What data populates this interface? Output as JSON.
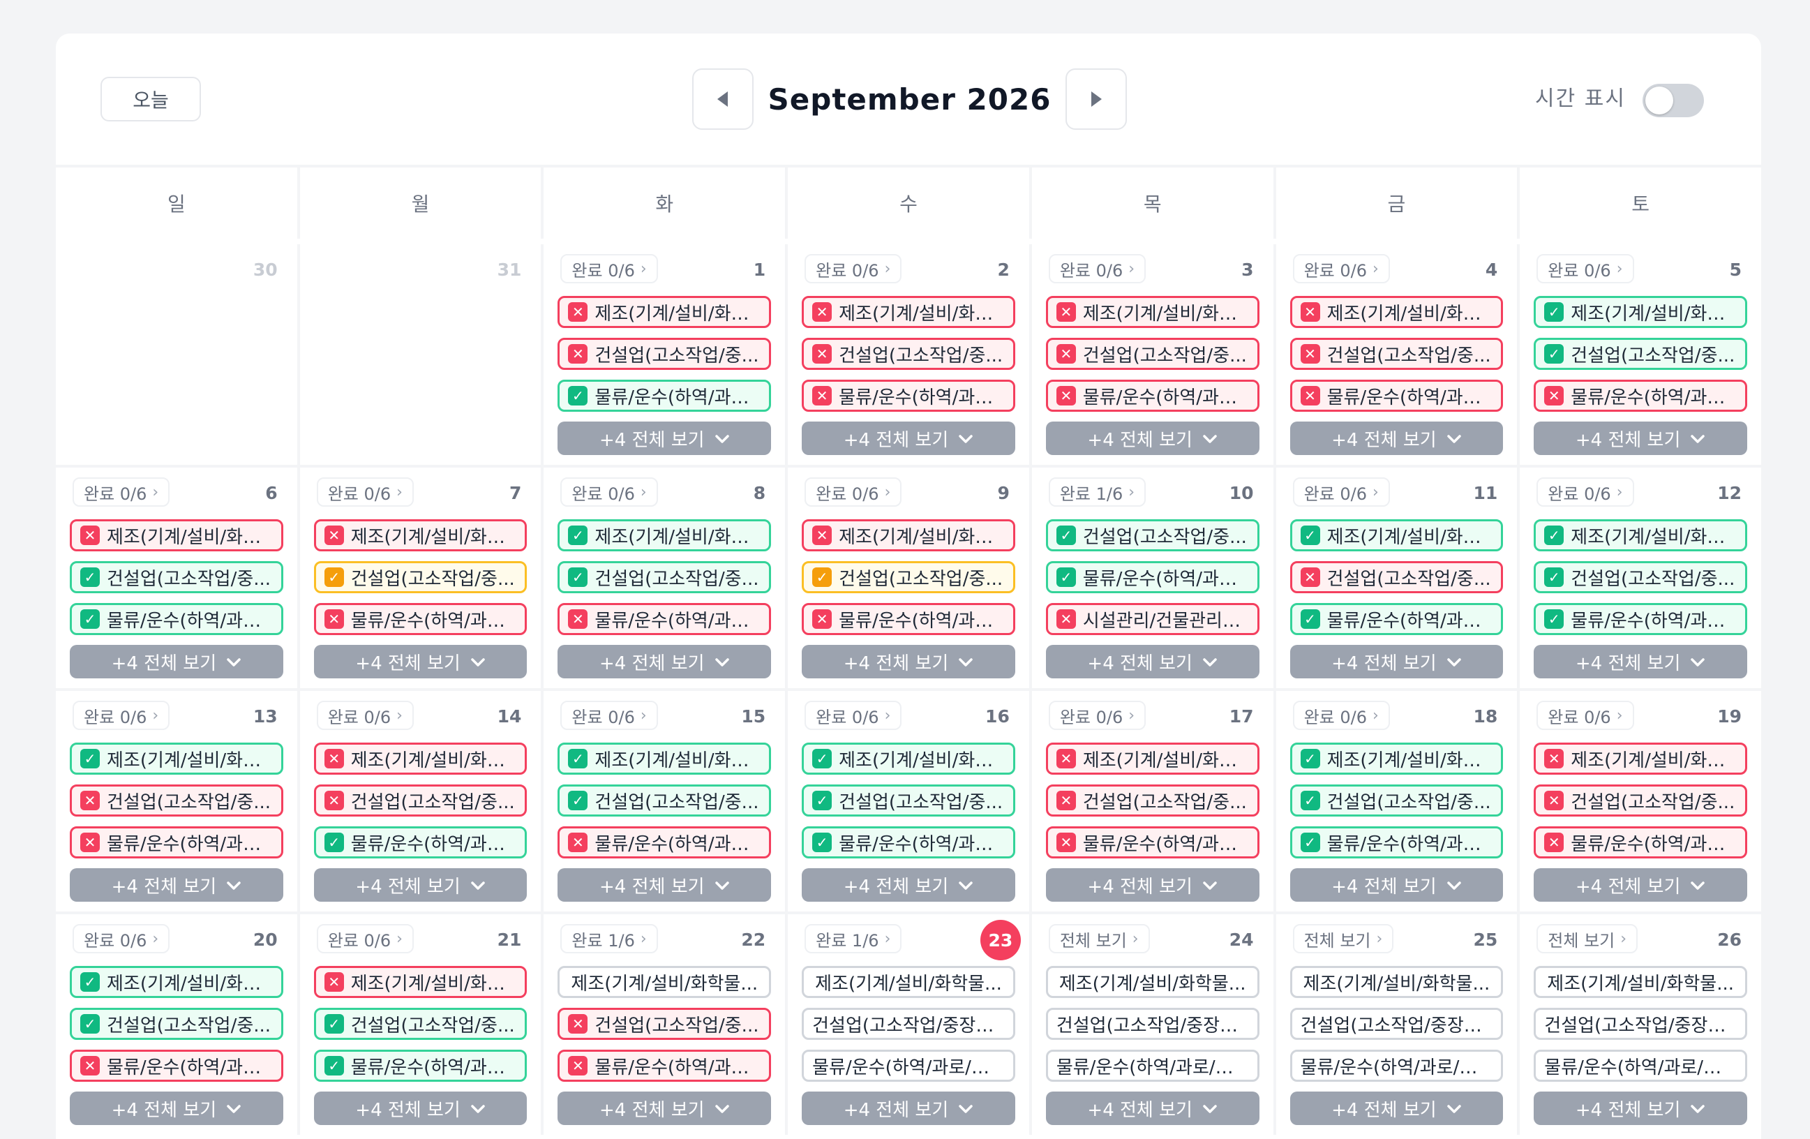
{
  "toolbar": {
    "today_label": "오늘",
    "month_title": "September 2026",
    "time_label": "시간 표시",
    "time_toggle_on": false
  },
  "weekdays": [
    "일",
    "월",
    "화",
    "수",
    "목",
    "금",
    "토"
  ],
  "more_label": "+4 전체 보기",
  "colors": {
    "done": "#10b981",
    "fail": "#f43f5e",
    "partial": "#f59e0b",
    "neutral": "#d1d5db",
    "today": "#f43f5e"
  },
  "labels": {
    "manufacturing": "제조(기계/설비/화학...",
    "construction": "건설업(고소작업/중...",
    "logistics": "물류/운수(하역/과로...",
    "facility": "시설관리/건물관리업...",
    "manufacturing_full": "제조(기계/설비/화학물...",
    "construction_full": "건설업(고소작업/중장비...",
    "logistics_full": "물류/운수(하역/과로/교..."
  },
  "days": [
    {
      "day": "30",
      "muted": true
    },
    {
      "day": "31",
      "muted": true
    },
    {
      "day": "1",
      "badge": "완료 0/6",
      "tasks": [
        [
          "fail",
          "manufacturing"
        ],
        [
          "fail",
          "construction"
        ],
        [
          "done",
          "logistics"
        ]
      ]
    },
    {
      "day": "2",
      "badge": "완료 0/6",
      "tasks": [
        [
          "fail",
          "manufacturing"
        ],
        [
          "fail",
          "construction"
        ],
        [
          "fail",
          "logistics"
        ]
      ]
    },
    {
      "day": "3",
      "badge": "완료 0/6",
      "tasks": [
        [
          "fail",
          "manufacturing"
        ],
        [
          "fail",
          "construction"
        ],
        [
          "fail",
          "logistics"
        ]
      ]
    },
    {
      "day": "4",
      "badge": "완료 0/6",
      "tasks": [
        [
          "fail",
          "manufacturing"
        ],
        [
          "fail",
          "construction"
        ],
        [
          "fail",
          "logistics"
        ]
      ]
    },
    {
      "day": "5",
      "badge": "완료 0/6",
      "tasks": [
        [
          "done",
          "manufacturing"
        ],
        [
          "done",
          "construction"
        ],
        [
          "fail",
          "logistics"
        ]
      ]
    },
    {
      "day": "6",
      "badge": "완료 0/6",
      "tasks": [
        [
          "fail",
          "manufacturing"
        ],
        [
          "done",
          "construction"
        ],
        [
          "done",
          "logistics"
        ]
      ]
    },
    {
      "day": "7",
      "badge": "완료 0/6",
      "tasks": [
        [
          "fail",
          "manufacturing"
        ],
        [
          "partial",
          "construction"
        ],
        [
          "fail",
          "logistics"
        ]
      ]
    },
    {
      "day": "8",
      "badge": "완료 0/6",
      "tasks": [
        [
          "done",
          "manufacturing"
        ],
        [
          "done",
          "construction"
        ],
        [
          "fail",
          "logistics"
        ]
      ]
    },
    {
      "day": "9",
      "badge": "완료 0/6",
      "tasks": [
        [
          "fail",
          "manufacturing"
        ],
        [
          "partial",
          "construction"
        ],
        [
          "fail",
          "logistics"
        ]
      ]
    },
    {
      "day": "10",
      "badge": "완료 1/6",
      "tasks": [
        [
          "done",
          "construction"
        ],
        [
          "done",
          "logistics"
        ],
        [
          "fail",
          "facility"
        ]
      ]
    },
    {
      "day": "11",
      "badge": "완료 0/6",
      "tasks": [
        [
          "done",
          "manufacturing"
        ],
        [
          "fail",
          "construction"
        ],
        [
          "done",
          "logistics"
        ]
      ]
    },
    {
      "day": "12",
      "badge": "완료 0/6",
      "tasks": [
        [
          "done",
          "manufacturing"
        ],
        [
          "done",
          "construction"
        ],
        [
          "done",
          "logistics"
        ]
      ]
    },
    {
      "day": "13",
      "badge": "완료 0/6",
      "tasks": [
        [
          "done",
          "manufacturing"
        ],
        [
          "fail",
          "construction"
        ],
        [
          "fail",
          "logistics"
        ]
      ]
    },
    {
      "day": "14",
      "badge": "완료 0/6",
      "tasks": [
        [
          "fail",
          "manufacturing"
        ],
        [
          "fail",
          "construction"
        ],
        [
          "done",
          "logistics"
        ]
      ]
    },
    {
      "day": "15",
      "badge": "완료 0/6",
      "tasks": [
        [
          "done",
          "manufacturing"
        ],
        [
          "done",
          "construction"
        ],
        [
          "fail",
          "logistics"
        ]
      ]
    },
    {
      "day": "16",
      "badge": "완료 0/6",
      "tasks": [
        [
          "done",
          "manufacturing"
        ],
        [
          "done",
          "construction"
        ],
        [
          "done",
          "logistics"
        ]
      ]
    },
    {
      "day": "17",
      "badge": "완료 0/6",
      "tasks": [
        [
          "fail",
          "manufacturing"
        ],
        [
          "fail",
          "construction"
        ],
        [
          "fail",
          "logistics"
        ]
      ]
    },
    {
      "day": "18",
      "badge": "완료 0/6",
      "tasks": [
        [
          "done",
          "manufacturing"
        ],
        [
          "done",
          "construction"
        ],
        [
          "done",
          "logistics"
        ]
      ]
    },
    {
      "day": "19",
      "badge": "완료 0/6",
      "tasks": [
        [
          "fail",
          "manufacturing"
        ],
        [
          "fail",
          "construction"
        ],
        [
          "fail",
          "logistics"
        ]
      ]
    },
    {
      "day": "20",
      "badge": "완료 0/6",
      "tasks": [
        [
          "done",
          "manufacturing"
        ],
        [
          "done",
          "construction"
        ],
        [
          "fail",
          "logistics"
        ]
      ]
    },
    {
      "day": "21",
      "badge": "완료 0/6",
      "tasks": [
        [
          "fail",
          "manufacturing"
        ],
        [
          "done",
          "construction"
        ],
        [
          "done",
          "logistics"
        ]
      ]
    },
    {
      "day": "22",
      "badge": "완료 1/6",
      "tasks": [
        [
          "none",
          "manufacturing_full"
        ],
        [
          "fail",
          "construction"
        ],
        [
          "fail",
          "logistics"
        ]
      ]
    },
    {
      "day": "23",
      "today": true,
      "badge": "완료 1/6",
      "tasks": [
        [
          "none",
          "manufacturing_full"
        ],
        [
          "none",
          "construction_full"
        ],
        [
          "none",
          "logistics_full"
        ]
      ]
    },
    {
      "day": "24",
      "badge": "전체 보기",
      "tasks": [
        [
          "none",
          "manufacturing_full"
        ],
        [
          "none",
          "construction_full"
        ],
        [
          "none",
          "logistics_full"
        ]
      ]
    },
    {
      "day": "25",
      "badge": "전체 보기",
      "tasks": [
        [
          "none",
          "manufacturing_full"
        ],
        [
          "none",
          "construction_full"
        ],
        [
          "none",
          "logistics_full"
        ]
      ]
    },
    {
      "day": "26",
      "badge": "전체 보기",
      "tasks": [
        [
          "none",
          "manufacturing_full"
        ],
        [
          "none",
          "construction_full"
        ],
        [
          "none",
          "logistics_full"
        ]
      ]
    }
  ]
}
